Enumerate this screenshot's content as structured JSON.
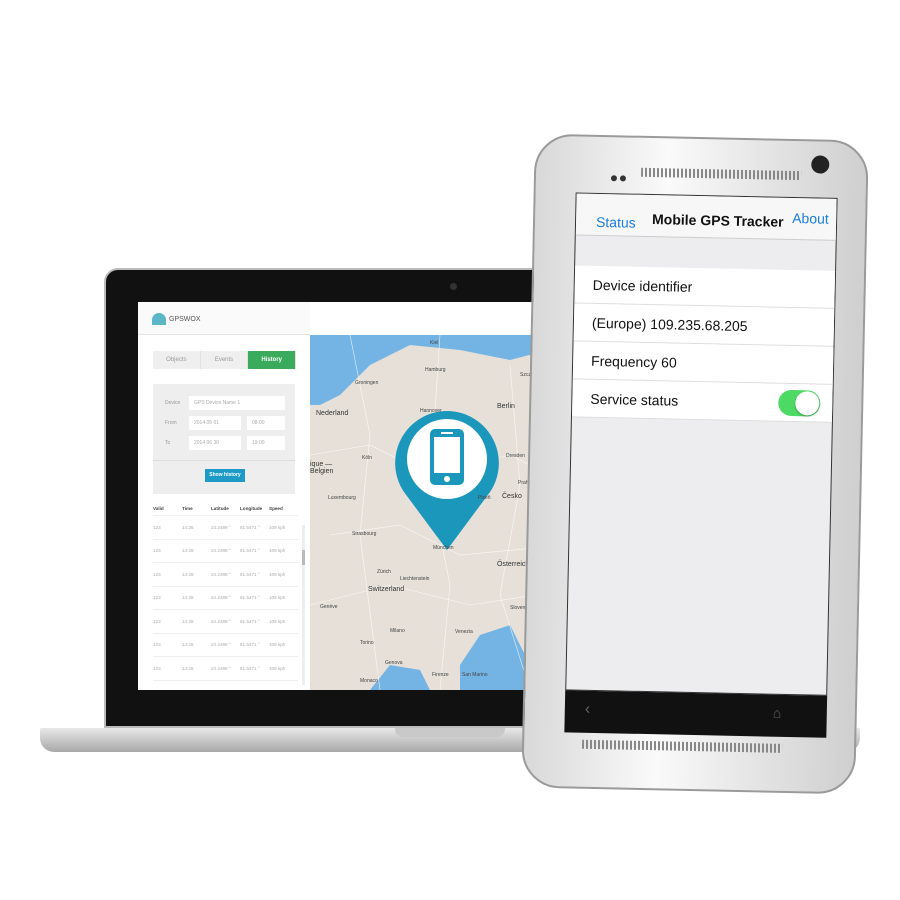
{
  "laptop": {
    "brand": "GPSWOX",
    "tabs": [
      {
        "label": "Objects"
      },
      {
        "label": "Events"
      },
      {
        "label": "History",
        "active": true
      }
    ],
    "form": {
      "device_label": "Device",
      "device_value": "GPS Device Name 1",
      "from_label": "From",
      "from_date": "2014 05 01",
      "from_time": "08:00",
      "to_label": "To",
      "to_date": "2014 06 30",
      "to_time": "19:00",
      "show_history": "Show history"
    },
    "table": {
      "headers": [
        "Valid",
        "Time",
        "Latitude",
        "Longitude",
        "Speed"
      ],
      "rows": [
        [
          "123",
          "14:28",
          "24.2489 °",
          "81.5471 °",
          "109 kph"
        ],
        [
          "123",
          "14:28",
          "24.2489 °",
          "81.5471 °",
          "109 kph"
        ],
        [
          "123",
          "14:28",
          "24.2489 °",
          "81.5471 °",
          "109 kph"
        ],
        [
          "123",
          "14:28",
          "24.2489 °",
          "81.5471 °",
          "109 kph"
        ],
        [
          "123",
          "14:28",
          "24.2489 °",
          "81.5471 °",
          "109 kph"
        ],
        [
          "123",
          "14:28",
          "24.2489 °",
          "81.5471 °",
          "109 kph"
        ],
        [
          "123",
          "14:28",
          "24.2489 °",
          "81.5471 °",
          "109 kph"
        ]
      ]
    },
    "map": {
      "labels": {
        "kiel": "Kiel",
        "hamburg": "Hamburg",
        "szczecin": "Szczecin",
        "groningen": "Groningen",
        "nederland": "Nederland",
        "hannover": "Hannover",
        "berlin": "Berlin",
        "koln": "Köln",
        "belgien": "ique — Belgien",
        "dresden": "Dresden",
        "praha": "Praha",
        "luxembourg": "Luxembourg",
        "plzen": "Plzeň",
        "cesko": "Česko",
        "strasbourg": "Strasbourg",
        "munchen": "München",
        "osterreich": "Österreich",
        "zurich": "Zürich",
        "liechtenstein": "Liechtenstein",
        "switzerland": "Switzerland",
        "geneve": "Genève",
        "slovenija": "Slovenija",
        "milano": "Milano",
        "venezia": "Venezia",
        "torino": "Torino",
        "genova": "Genova",
        "monaco": "Monaco",
        "firenze": "Firenze",
        "sanmarino": "San Marino"
      },
      "pin_icon": "smartphone-icon",
      "pin_color": "#1b97bb"
    }
  },
  "phone": {
    "nav": {
      "left": "Status",
      "title": "Mobile GPS Tracker",
      "right": "About"
    },
    "rows": [
      {
        "label": "Device identifier"
      },
      {
        "label": "(Europe) 109.235.68.205"
      },
      {
        "label": "Frequency 60"
      },
      {
        "label": "Service status",
        "toggle": true
      }
    ],
    "accent": "#1a7fe0",
    "toggle_color": "#4cd964"
  }
}
